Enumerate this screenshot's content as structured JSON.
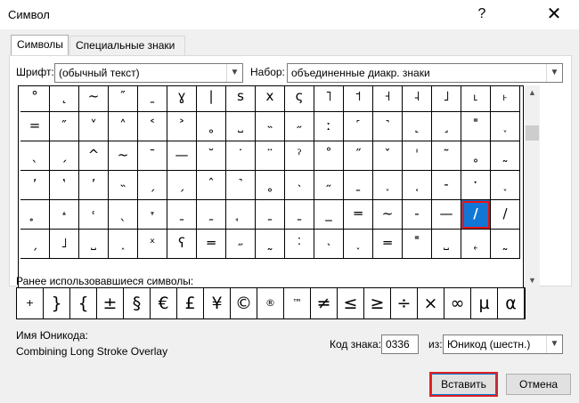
{
  "window": {
    "title": "Символ",
    "help_icon": "?",
    "close_icon": "✕"
  },
  "tabs": [
    {
      "label": "Символы",
      "active": true
    },
    {
      "label": "Специальные знаки",
      "active": false
    }
  ],
  "font": {
    "label": "Шрифт:",
    "value": "(обычный текст)"
  },
  "subset": {
    "label": "Набор:",
    "value": "объединенные диакр. знаки"
  },
  "grid_rows": [
    [
      "°",
      "˛",
      "~",
      "″",
      "ˍ",
      "ɣ",
      "|",
      "s",
      "x",
      "ς",
      "˥",
      "˦",
      "˧",
      "˨",
      "˩",
      "˪",
      "˫"
    ],
    [
      "=",
      "″",
      "˅",
      "˄",
      "˂",
      "˃",
      "˳",
      "˽",
      "˵",
      "˶",
      "ː",
      "˹",
      "˺",
      "˻",
      "˼",
      "˭",
      "˯"
    ],
    [
      "ˎ",
      "ˏ",
      "^",
      "~",
      "¯",
      "—",
      "˘",
      "˙",
      "¨",
      "ˀ",
      "˚",
      "˝",
      "ˇ",
      "ˈ",
      "˜",
      "˳",
      "˷"
    ],
    [
      "’",
      "‛",
      "’",
      "˵",
      "ˏ",
      "ˏ",
      "ˆ",
      "˺",
      "˳",
      "˴",
      "˶",
      "ˍ",
      "˯",
      "˱",
      "-",
      "ˑ",
      "˯"
    ],
    [
      "̥",
      "˔",
      "˓",
      "ˎ",
      "˕",
      "ˍ",
      "ˍ",
      "̘",
      "ˍ",
      "ˍ",
      "_",
      "═",
      "~",
      "-",
      "—",
      "/",
      "/"
    ],
    [
      "ˏ",
      "˩",
      "˽",
      "˰",
      "ˣ",
      "ʕ",
      "═",
      "˶",
      "˷",
      "˸",
      "˴",
      "˯",
      "═",
      "˭",
      "˽",
      "˿",
      "˷"
    ]
  ],
  "recent_label": "Ранее использовавшиеся символы:",
  "recent": [
    "+",
    "}",
    "{",
    "±",
    "§",
    "€",
    "£",
    "¥",
    "©",
    "®",
    "™",
    "≠",
    "≤",
    "≥",
    "÷",
    "×",
    "∞",
    "µ",
    "α"
  ],
  "unicode_name_label": "Имя Юникода:",
  "unicode_name": "Combining Long Stroke Overlay",
  "code_label": "Код знака:",
  "code_value": "0336",
  "from_label": "из:",
  "from_value": "Юникод (шестн.)",
  "buttons": {
    "insert": "Вставить",
    "cancel": "Отмена"
  },
  "selected_cell": {
    "row": 4,
    "col": 15
  },
  "colors": {
    "selection": "#1177d7",
    "highlight": "#e02020"
  }
}
